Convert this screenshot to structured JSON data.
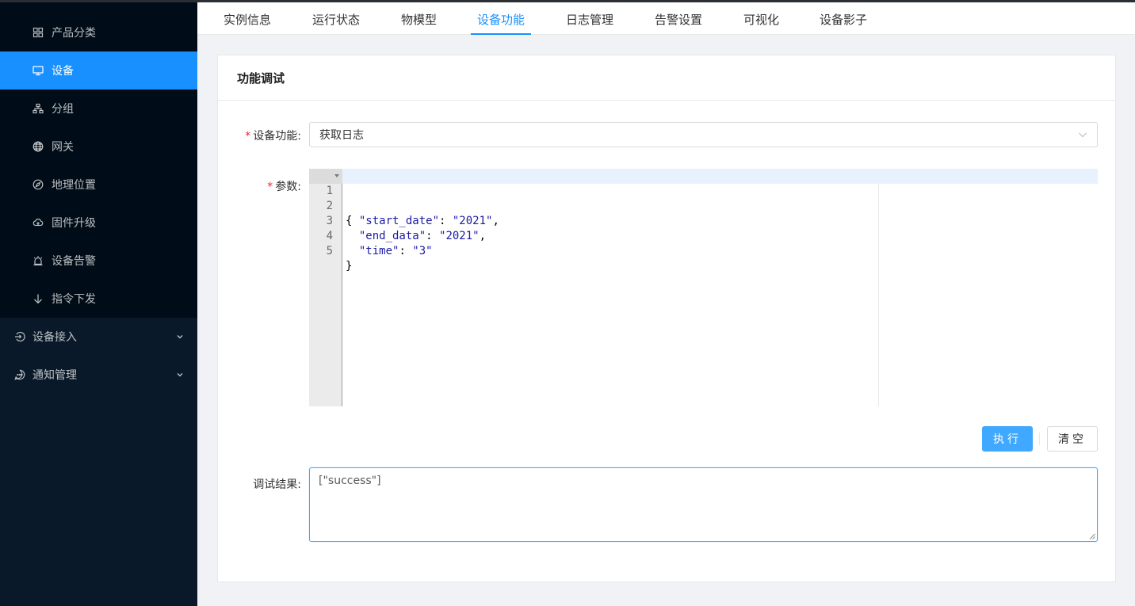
{
  "sidebar": {
    "items": [
      {
        "label": "产品分类",
        "icon": "grid-icon"
      },
      {
        "label": "设备",
        "icon": "monitor-icon",
        "active": true
      },
      {
        "label": "分组",
        "icon": "cluster-icon"
      },
      {
        "label": "网关",
        "icon": "globe-icon"
      },
      {
        "label": "地理位置",
        "icon": "compass-icon"
      },
      {
        "label": "固件升级",
        "icon": "cloud-upload-icon"
      },
      {
        "label": "设备告警",
        "icon": "alarm-icon"
      },
      {
        "label": "指令下发",
        "icon": "arrow-down-icon"
      }
    ],
    "groups": [
      {
        "label": "设备接入",
        "icon": "login-icon"
      },
      {
        "label": "通知管理",
        "icon": "message-icon"
      }
    ]
  },
  "tabs": [
    {
      "label": "实例信息"
    },
    {
      "label": "运行状态"
    },
    {
      "label": "物模型"
    },
    {
      "label": "设备功能",
      "active": true
    },
    {
      "label": "日志管理"
    },
    {
      "label": "告警设置"
    },
    {
      "label": "可视化"
    },
    {
      "label": "设备影子"
    }
  ],
  "card": {
    "title": "功能调试",
    "function_label": "设备功能:",
    "function_value": "获取日志",
    "params_label": "参数:",
    "result_label": "调试结果:",
    "result_value": "[\"success\"]",
    "execute_label": "执行",
    "clear_label": "清空"
  },
  "editor": {
    "lines": [
      {
        "n": "1",
        "text": "{"
      },
      {
        "n": "2",
        "key": "\"start_date\"",
        "value": "\"2021\"",
        "tail": ","
      },
      {
        "n": "3",
        "key": "\"end_data\"",
        "value": "\"2021\"",
        "tail": ","
      },
      {
        "n": "4",
        "key": "\"time\"",
        "value": "\"3\"",
        "tail": ""
      },
      {
        "n": "5",
        "text": "}"
      }
    ]
  },
  "colors": {
    "accent": "#1890ff",
    "sidebar_bg": "#0a1929",
    "required": "#f5222d"
  }
}
